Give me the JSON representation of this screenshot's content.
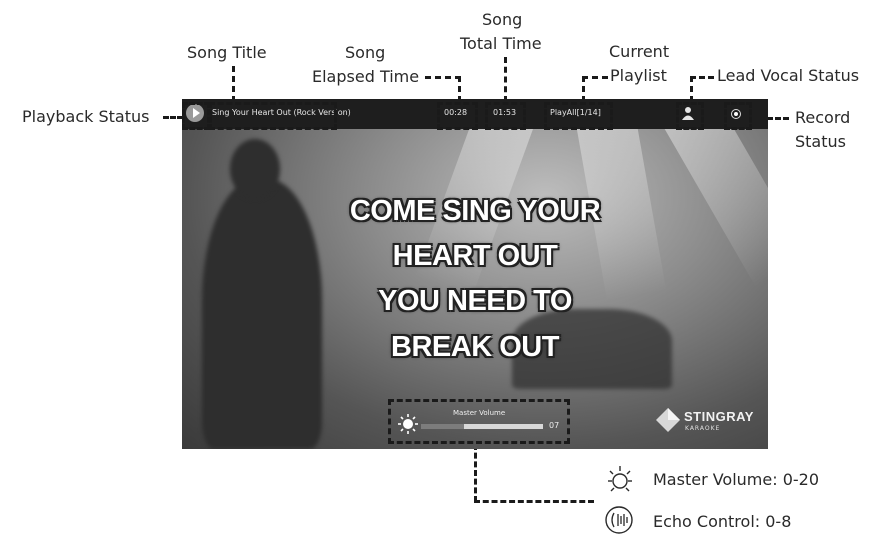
{
  "callouts": {
    "playback_status": "Playback Status",
    "song_title": "Song Title",
    "elapsed_line1": "Song",
    "elapsed_line2": "Elapsed Time",
    "total_line1": "Song",
    "total_line2": "Total Time",
    "playlist_line1": "Current",
    "playlist_line2": "Playlist",
    "lead_vocal": "Lead Vocal Status",
    "record_line1": "Record",
    "record_line2": "Status"
  },
  "screen": {
    "song_title": "Sing Your Heart Out (Rock Version)",
    "elapsed_time": "00:28",
    "total_time": "01:53",
    "playlist": "PlayAll[1/14]",
    "lyrics": [
      "COME SING YOUR",
      "HEART OUT",
      "YOU NEED TO",
      "BREAK OUT"
    ],
    "volume": {
      "title": "Master Volume",
      "value": "07",
      "fraction": 0.35
    },
    "logo": {
      "name": "STINGRAY",
      "sub": "KARAOKE"
    }
  },
  "legend": {
    "master_volume": "Master Volume: 0-20",
    "echo_control": "Echo Control: 0-8",
    "master_icon": "sun-icon",
    "echo_icon": "echo-icon"
  }
}
